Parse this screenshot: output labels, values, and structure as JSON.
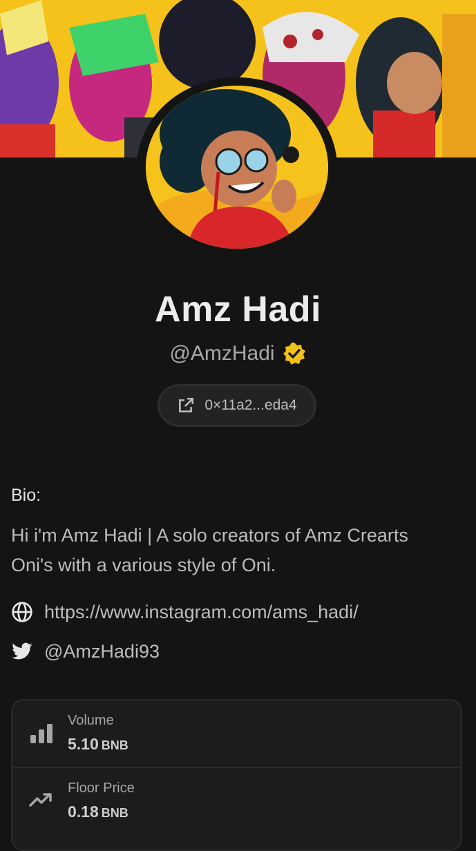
{
  "profile": {
    "name": "Amz Hadi",
    "handle": "@AmzHadi",
    "verified": true,
    "address": "0×11a2...eda4"
  },
  "bio": {
    "label": "Bio:",
    "text": "Hi i'm Amz Hadi | A solo creators of Amz Crearts Oni's with a various style of Oni."
  },
  "links": {
    "website": "https://www.instagram.com/ams_hadi/",
    "twitter": "@AmzHadi93"
  },
  "stats": [
    {
      "label": "Volume",
      "value": "5.10",
      "unit": "BNB",
      "icon": "bar-chart-icon"
    },
    {
      "label": "Floor Price",
      "value": "0.18",
      "unit": "BNB",
      "icon": "trending-up-icon"
    }
  ],
  "colors": {
    "background": "#141414",
    "verified_badge": "#f2c21a",
    "banner": "#f2c21a"
  }
}
